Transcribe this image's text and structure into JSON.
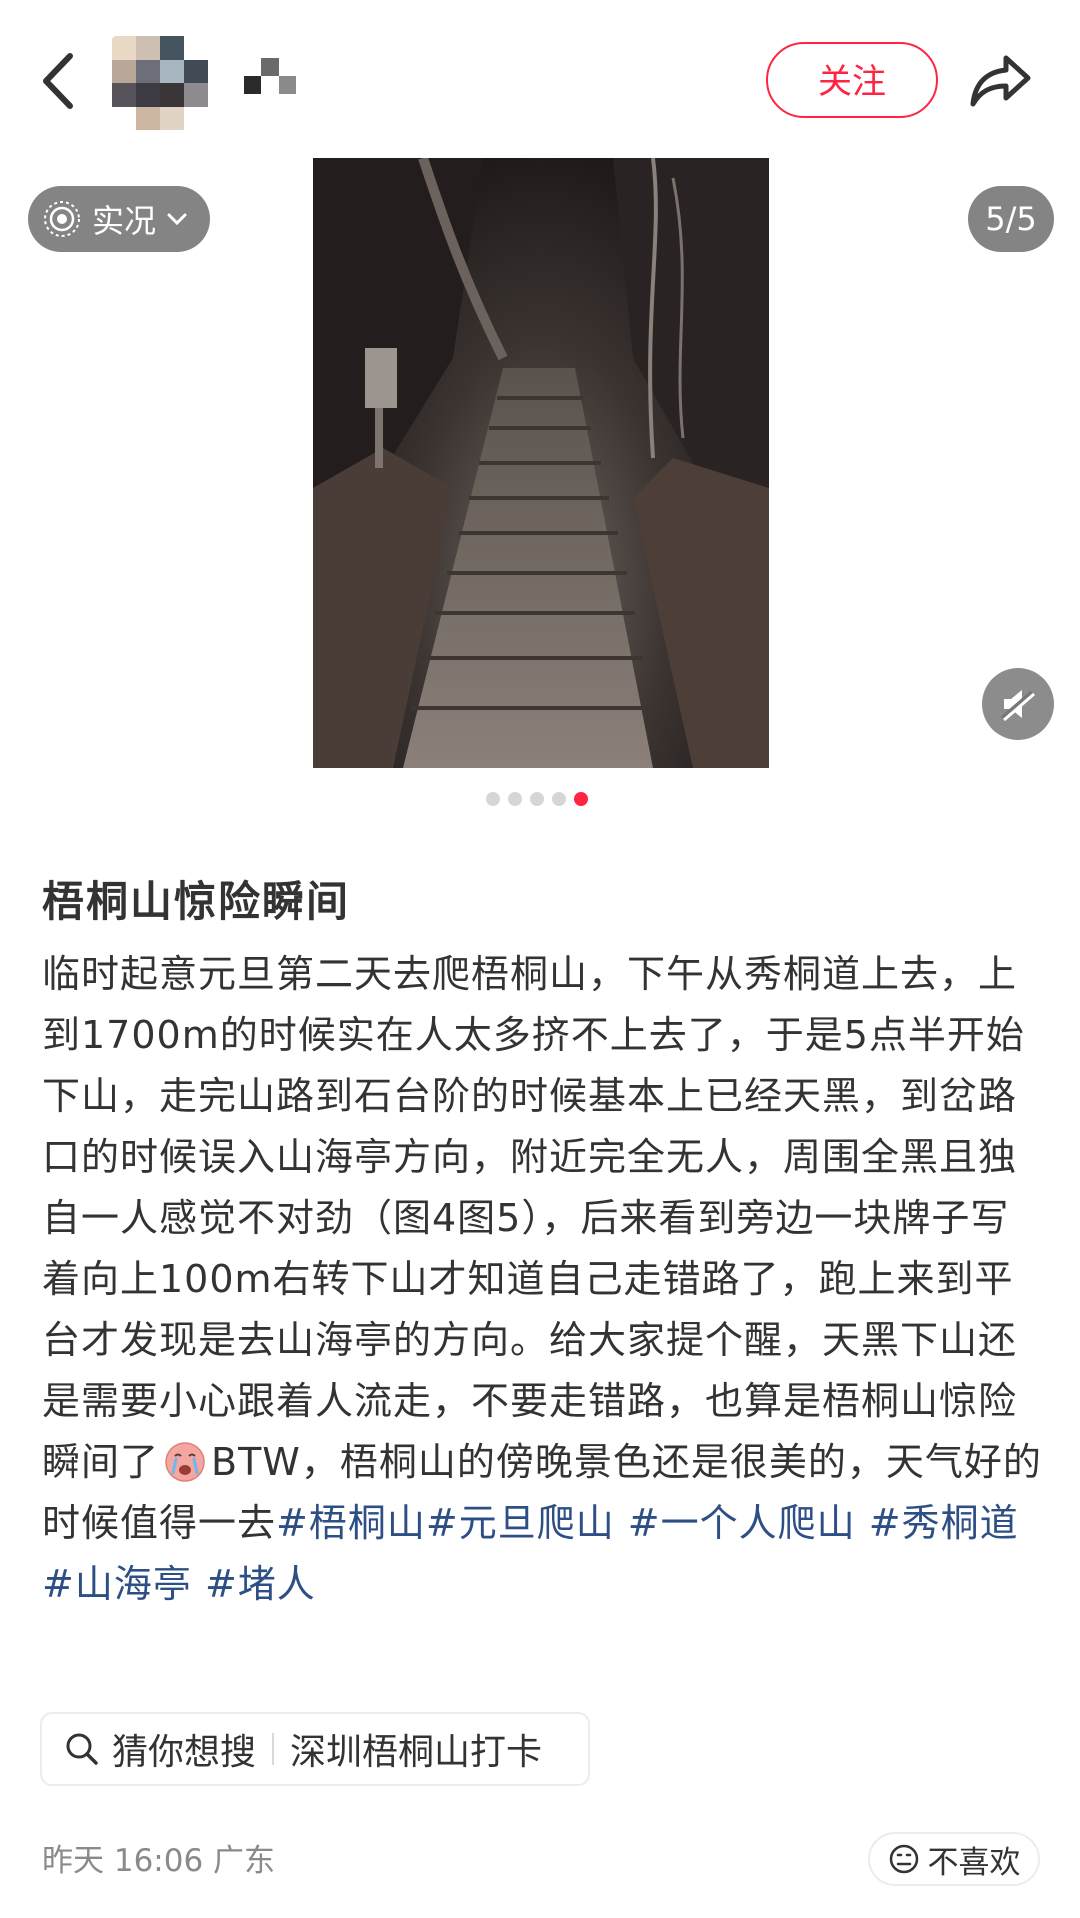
{
  "header": {
    "follow_label": "关注"
  },
  "media": {
    "live_label": "实况",
    "counter": "5/5",
    "image_count": 5,
    "current_index": 5
  },
  "note": {
    "title": "梧桐山惊险瞬间",
    "body_part1": "临时起意元旦第二天去爬梧桐山，下午从秀桐道上去，上到1700m的时候实在人太多挤不上去了，于是5点半开始下山，走完山路到石台阶的时候基本上已经天黑，到岔路口的时候误入山海亭方向，附近完全无人，周围全黑且独自一人感觉不对劲（图4图5），后来看到旁边一块牌子写着向上100m右转下山才知道自己走错路了，跑上来到平台才发现是去山海亭的方向。给大家提个醒，天黑下山还是需要小心跟着人流走，不要走错路，也算是梧桐山惊险瞬间了",
    "body_part2": "BTW，梧桐山的傍晚景色还是很美的，天气好的时候值得一去",
    "tags": [
      "#梧桐山",
      "#元旦爬山",
      "#一个人爬山",
      "#秀桐道",
      "#山海亭",
      "#堵人"
    ]
  },
  "search": {
    "label": "猜你想搜",
    "query": "深圳梧桐山打卡"
  },
  "meta": {
    "date": "昨天 16:06 广东",
    "dislike_label": "不喜欢"
  },
  "colors": {
    "accent": "#ff2442",
    "tag": "#2e4f86",
    "muted": "#8a8a8a"
  }
}
